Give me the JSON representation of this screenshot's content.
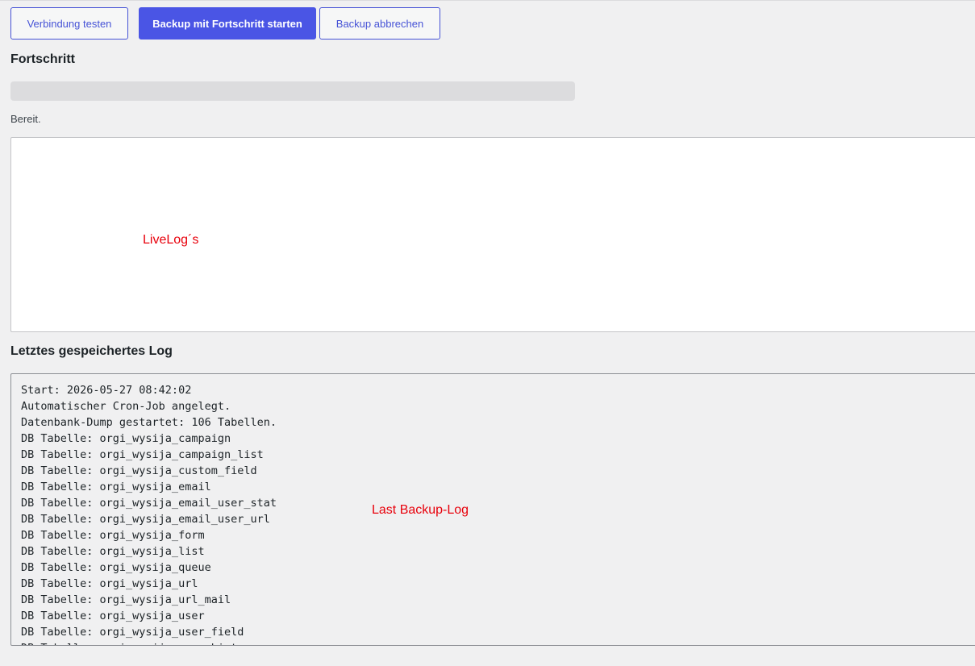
{
  "toolbar": {
    "test_label": "Verbindung testen",
    "start_label": "Backup mit Fortschritt starten",
    "abort_label": "Backup abbrechen"
  },
  "progress": {
    "heading": "Fortschritt",
    "value": 0,
    "status": "Bereit."
  },
  "live_log": {
    "annotation": "LiveLog´s"
  },
  "saved_log": {
    "heading": "Letztes gespeichertes Log",
    "annotation": "Last Backup-Log",
    "lines": [
      "Start: 2026-05-27 08:42:02",
      "Automatischer Cron-Job angelegt.",
      "Datenbank-Dump gestartet: 106 Tabellen.",
      "DB Tabelle: orgi_wysija_campaign",
      "DB Tabelle: orgi_wysija_campaign_list",
      "DB Tabelle: orgi_wysija_custom_field",
      "DB Tabelle: orgi_wysija_email",
      "DB Tabelle: orgi_wysija_email_user_stat",
      "DB Tabelle: orgi_wysija_email_user_url",
      "DB Tabelle: orgi_wysija_form",
      "DB Tabelle: orgi_wysija_list",
      "DB Tabelle: orgi_wysija_queue",
      "DB Tabelle: orgi_wysija_url",
      "DB Tabelle: orgi_wysija_url_mail",
      "DB Tabelle: orgi_wysija_user",
      "DB Tabelle: orgi_wysija_user_field",
      "DB Tabelle: orgi_wysija_user_history"
    ]
  },
  "colors": {
    "accent": "#4a55e5",
    "annotation": "#e8000b"
  }
}
